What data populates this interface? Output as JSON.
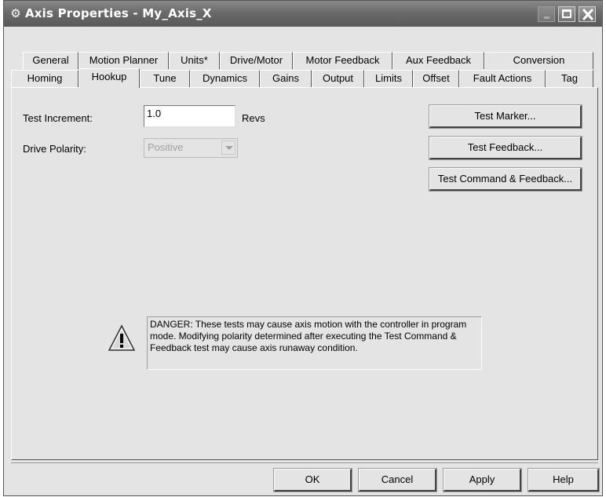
{
  "window": {
    "title": "Axis Properties - My_Axis_X"
  },
  "tabs": {
    "row1": [
      "General",
      "Motion Planner",
      "Units*",
      "Drive/Motor",
      "Motor Feedback",
      "Aux Feedback",
      "Conversion"
    ],
    "row2": [
      "Homing",
      "Hookup",
      "Tune",
      "Dynamics",
      "Gains",
      "Output",
      "Limits",
      "Offset",
      "Fault Actions",
      "Tag"
    ],
    "active": "Hookup"
  },
  "hookup": {
    "test_increment_label": "Test Increment:",
    "test_increment_value": "1.0",
    "test_increment_unit": "Revs",
    "drive_polarity_label": "Drive Polarity:",
    "drive_polarity_value": "Positive",
    "test_marker_button": "Test Marker...",
    "test_feedback_button": "Test Feedback...",
    "test_command_feedback_button": "Test Command & Feedback...",
    "danger_text": "DANGER: These tests may cause axis motion with the controller in program mode. Modifying polarity determined after executing the Test Command & Feedback test may cause axis runaway condition."
  },
  "footer": {
    "ok": "OK",
    "cancel": "Cancel",
    "apply": "Apply",
    "help": "Help"
  },
  "colors": {
    "title_bar": "#6a6a6a",
    "dialog_bg": "#e4e4e4",
    "disabled_text": "#a0a0a0"
  },
  "icons": {
    "title": "gear-icon",
    "warning": "warning-icon"
  }
}
